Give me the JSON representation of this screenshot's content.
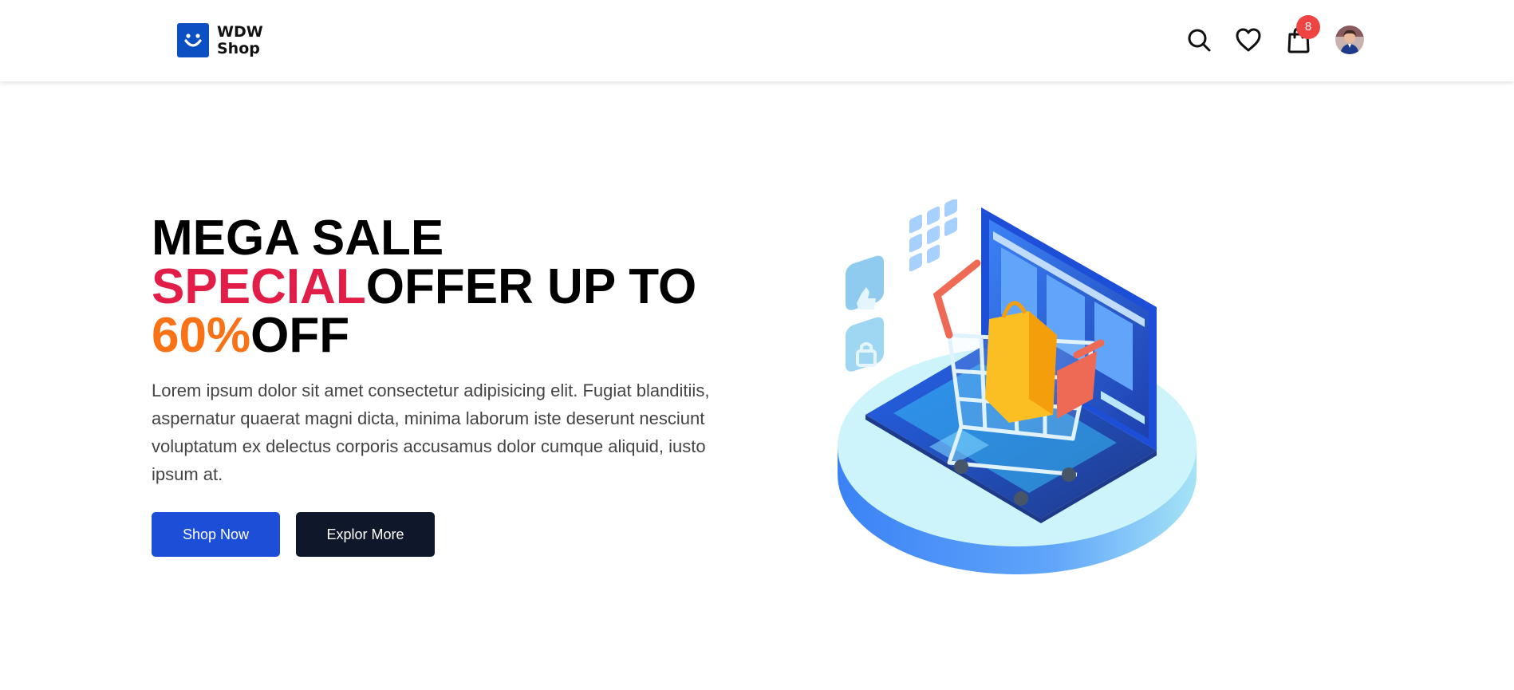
{
  "header": {
    "brand_line1": "WDW",
    "brand_line2": "Shop",
    "brand_color": "#0b4fc2",
    "icons": [
      "search-icon",
      "heart-icon",
      "shopping-bag-icon",
      "avatar"
    ],
    "cart_count": "8",
    "badge_color": "#ef4444"
  },
  "hero": {
    "title_line1": "MEGA SALE",
    "title_special": "SPECIAL",
    "title_offer": "OFFER UP TO",
    "title_percent": "60%",
    "title_off": "OFF",
    "description": "Lorem ipsum dolor sit amet consectetur adipisicing elit. Fugiat blanditiis, aspernatur quaerat magni dicta, minima laborum iste deserunt nesciunt voluptatum ex delectus corporis accusamus dolor cumque aliquid, iusto ipsum at.",
    "shop_button": "Shop Now",
    "explore_button": "Explor More",
    "accent_pink": "#e11d48",
    "accent_orange": "#f97316",
    "primary_blue": "#1d4ed8",
    "dark_navy": "#0f172a"
  }
}
